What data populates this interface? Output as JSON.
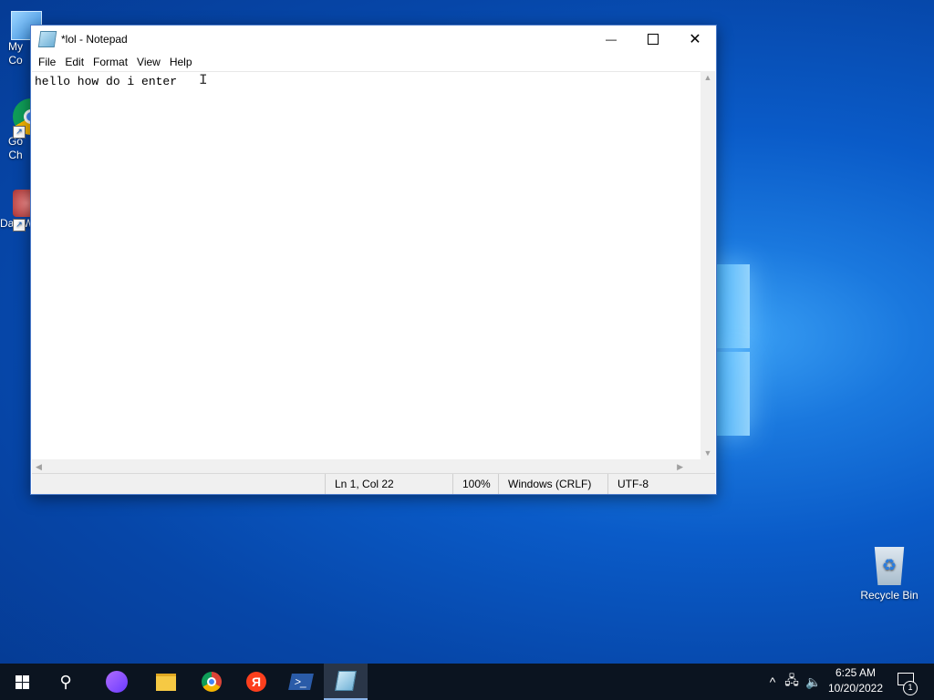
{
  "desktop": {
    "icons": {
      "my_computer": "My Co",
      "chrome_line1": "Go",
      "chrome_line2": "Ch",
      "dataw": "DataW",
      "recycle_bin": "Recycle Bin"
    }
  },
  "notepad": {
    "title": "*lol - Notepad",
    "menu": [
      "File",
      "Edit",
      "Format",
      "View",
      "Help"
    ],
    "content": "hello how do i enter ",
    "status": {
      "position": "Ln 1, Col 22",
      "zoom": "100%",
      "line_ending": "Windows (CRLF)",
      "encoding": "UTF-8"
    },
    "controls": {
      "minimize": "—",
      "close": "✕"
    }
  },
  "taskbar": {
    "items": [
      {
        "name": "start-button",
        "active": false
      },
      {
        "name": "search-button",
        "active": false
      },
      {
        "name": "alice-app",
        "active": false
      },
      {
        "name": "file-explorer-app",
        "active": false
      },
      {
        "name": "chrome-app",
        "active": false
      },
      {
        "name": "yandex-app",
        "active": false
      },
      {
        "name": "powershell-app",
        "active": false
      },
      {
        "name": "notepad-app",
        "active": true
      }
    ],
    "yandex_glyph": "Я",
    "tray": {
      "chevron": "^",
      "time": "6:25 AM",
      "date": "10/20/2022",
      "notifications_count": "1"
    }
  }
}
